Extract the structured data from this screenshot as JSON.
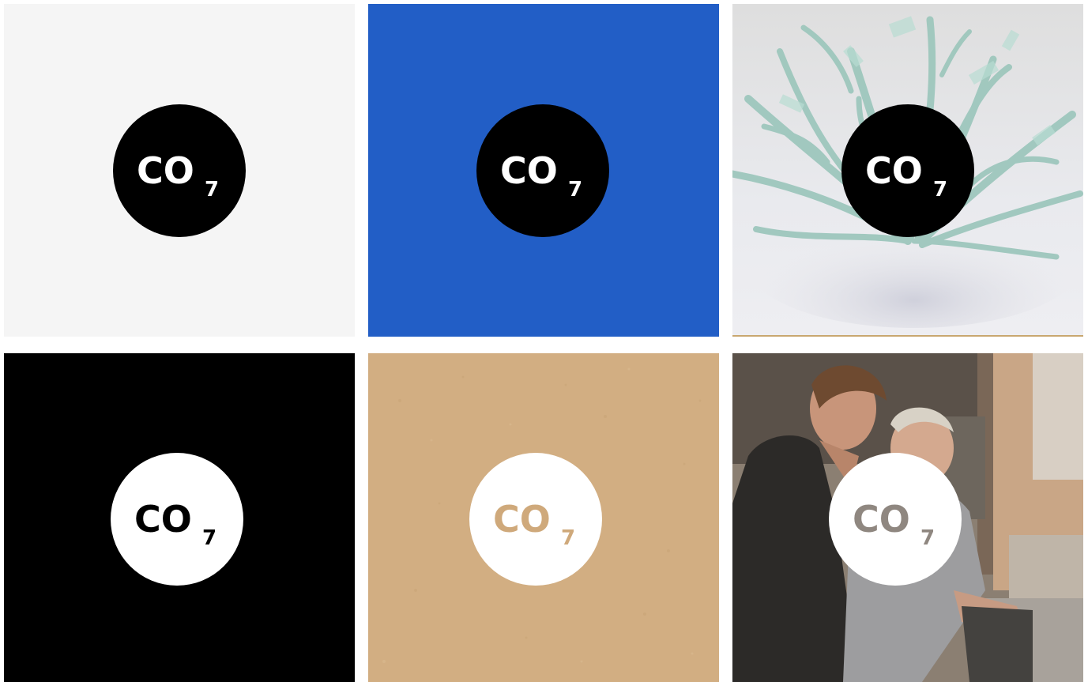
{
  "logo": {
    "main": "CO",
    "sub": "7"
  },
  "colors": {
    "light_gray": "#f5f5f5",
    "brand_blue": "#225ec6",
    "black": "#000000",
    "white": "#ffffff",
    "kraft": "#d2ae82",
    "kraft_text": "#cfa97b"
  },
  "tiles": [
    {
      "background": "light gray",
      "logo_circle": "black",
      "logo_text": "white"
    },
    {
      "background": "blue",
      "logo_circle": "black",
      "logo_text": "white"
    },
    {
      "background": "glass sculpture",
      "logo_circle": "black",
      "logo_text": "white"
    },
    {
      "background": "black",
      "logo_circle": "white",
      "logo_text": "black"
    },
    {
      "background": "kraft paper",
      "logo_circle": "white",
      "logo_text": "kraft"
    },
    {
      "background": "workshop photo",
      "logo_circle": "white",
      "logo_text": "photo"
    }
  ]
}
